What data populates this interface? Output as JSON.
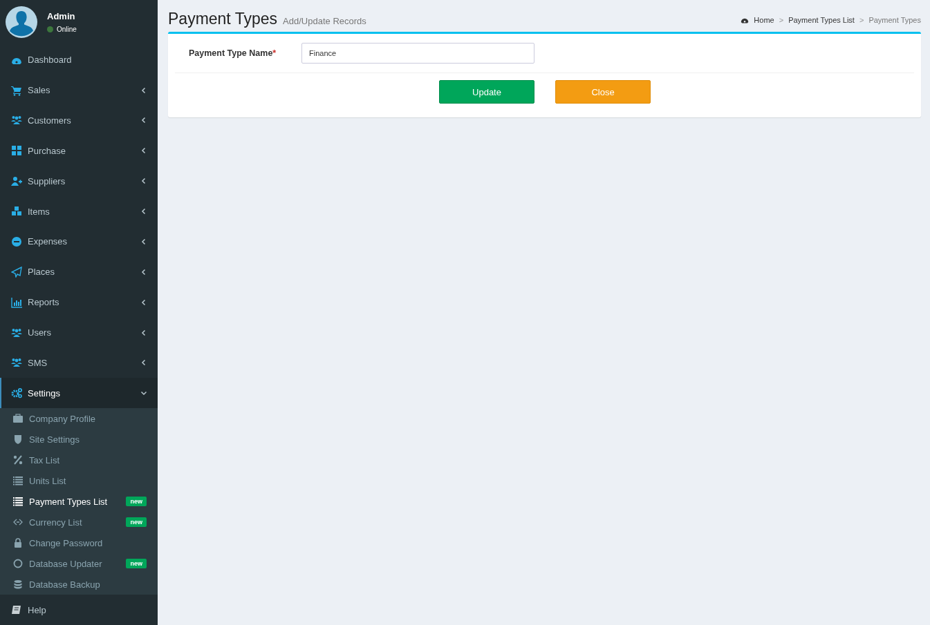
{
  "user": {
    "name": "Admin",
    "status": "Online",
    "online": true
  },
  "menu": [
    {
      "label": "Dashboard",
      "kind": "link",
      "expanded": false,
      "selected": false
    },
    {
      "label": "Sales",
      "kind": "tree",
      "expanded": false,
      "selected": false
    },
    {
      "label": "Customers",
      "kind": "tree",
      "expanded": false,
      "selected": false
    },
    {
      "label": "Purchase",
      "kind": "tree",
      "expanded": false,
      "selected": false
    },
    {
      "label": "Suppliers",
      "kind": "tree",
      "expanded": false,
      "selected": false
    },
    {
      "label": "Items",
      "kind": "tree",
      "expanded": false,
      "selected": false
    },
    {
      "label": "Expenses",
      "kind": "tree",
      "expanded": false,
      "selected": false
    },
    {
      "label": "Places",
      "kind": "tree",
      "expanded": false,
      "selected": false
    },
    {
      "label": "Reports",
      "kind": "tree",
      "expanded": false,
      "selected": false
    },
    {
      "label": "Users",
      "kind": "tree",
      "expanded": false,
      "selected": false
    },
    {
      "label": "SMS",
      "kind": "tree",
      "expanded": false,
      "selected": false
    },
    {
      "label": "Settings",
      "kind": "tree",
      "expanded": true,
      "selected": true,
      "children": [
        {
          "label": "Company Profile",
          "selected": false
        },
        {
          "label": "Site Settings",
          "selected": false
        },
        {
          "label": "Tax List",
          "selected": false
        },
        {
          "label": "Units List",
          "selected": false
        },
        {
          "label": "Payment Types List",
          "selected": true,
          "badge": "new"
        },
        {
          "label": "Currency List",
          "selected": false,
          "badge": "new"
        },
        {
          "label": "Change Password",
          "selected": false
        },
        {
          "label": "Database Updater",
          "selected": false,
          "badge": "new"
        },
        {
          "label": "Database Backup",
          "selected": false
        }
      ]
    },
    {
      "label": "Help",
      "kind": "link",
      "expanded": false,
      "selected": false
    }
  ],
  "page": {
    "title": "Payment Types",
    "subtitle": "Add/Update Records"
  },
  "breadcrumb": [
    {
      "label": "Home",
      "separator": ">"
    },
    {
      "label": "Payment Types List",
      "separator": ">"
    },
    {
      "label": "Payment Types"
    }
  ],
  "form": {
    "label": "Payment Type Name",
    "required_mark": "*",
    "value": "Finance"
  },
  "buttons": [
    {
      "label": "Update",
      "kind": "primary"
    },
    {
      "label": "Close",
      "kind": "warning"
    }
  ]
}
